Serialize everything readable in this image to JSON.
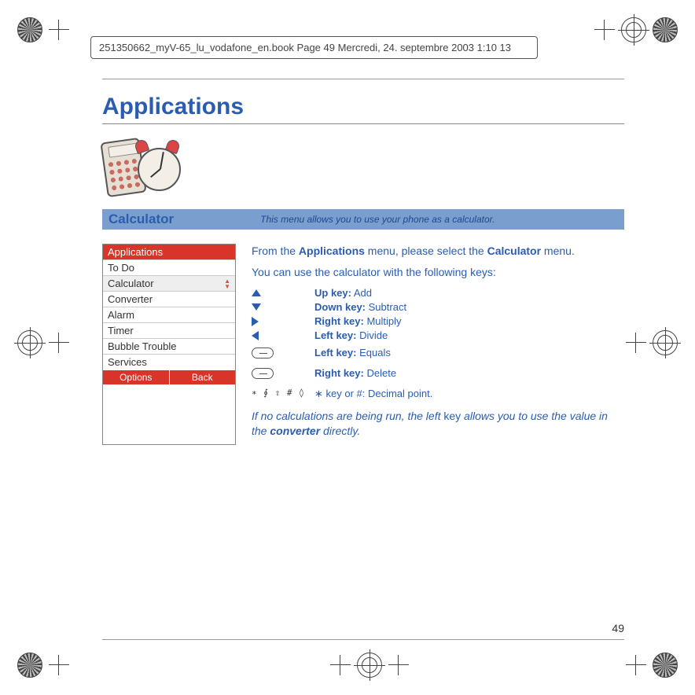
{
  "book_header": "251350662_myV-65_lu_vodafone_en.book  Page 49  Mercredi, 24. septembre 2003  1:10 13",
  "title": "Applications",
  "section": {
    "title": "Calculator",
    "desc": "This menu allows you to use your phone as a calculator."
  },
  "phone_list": {
    "header": "Applications",
    "items": [
      "To Do",
      "Calculator",
      "Converter",
      "Alarm",
      "Timer",
      "Bubble Trouble",
      "Services"
    ],
    "selected_index": 1,
    "footer": {
      "left": "Options",
      "right": "Back"
    }
  },
  "intro": {
    "p1a": "From the ",
    "p1b": "Applications",
    "p1c": " menu, please select the ",
    "p1d": "Calculator",
    "p1e": " menu.",
    "p2": "You can use the calculator with the following keys:"
  },
  "keys": {
    "up": {
      "label": "Up key:",
      "action": "Add"
    },
    "down": {
      "label": "Down key:",
      "action": "Subtract"
    },
    "right": {
      "label": "Right key:",
      "action": "Multiply"
    },
    "left": {
      "label": "Left key:",
      "action": "Divide"
    },
    "soft_l": {
      "label": "Left key:",
      "action": "Equals"
    },
    "soft_r": {
      "label": "Right key:",
      "action": "Delete"
    },
    "sym": {
      "glyphs": "∗ ∮ ⇧   # ◊",
      "label": "∗ key or #",
      "action": ": Decimal point."
    }
  },
  "note": {
    "a": "If no calculations are being run, the left ",
    "b": "key",
    "c": " allows you to use the value in the ",
    "d": "converter",
    "e": " directly."
  },
  "page_num": "49"
}
